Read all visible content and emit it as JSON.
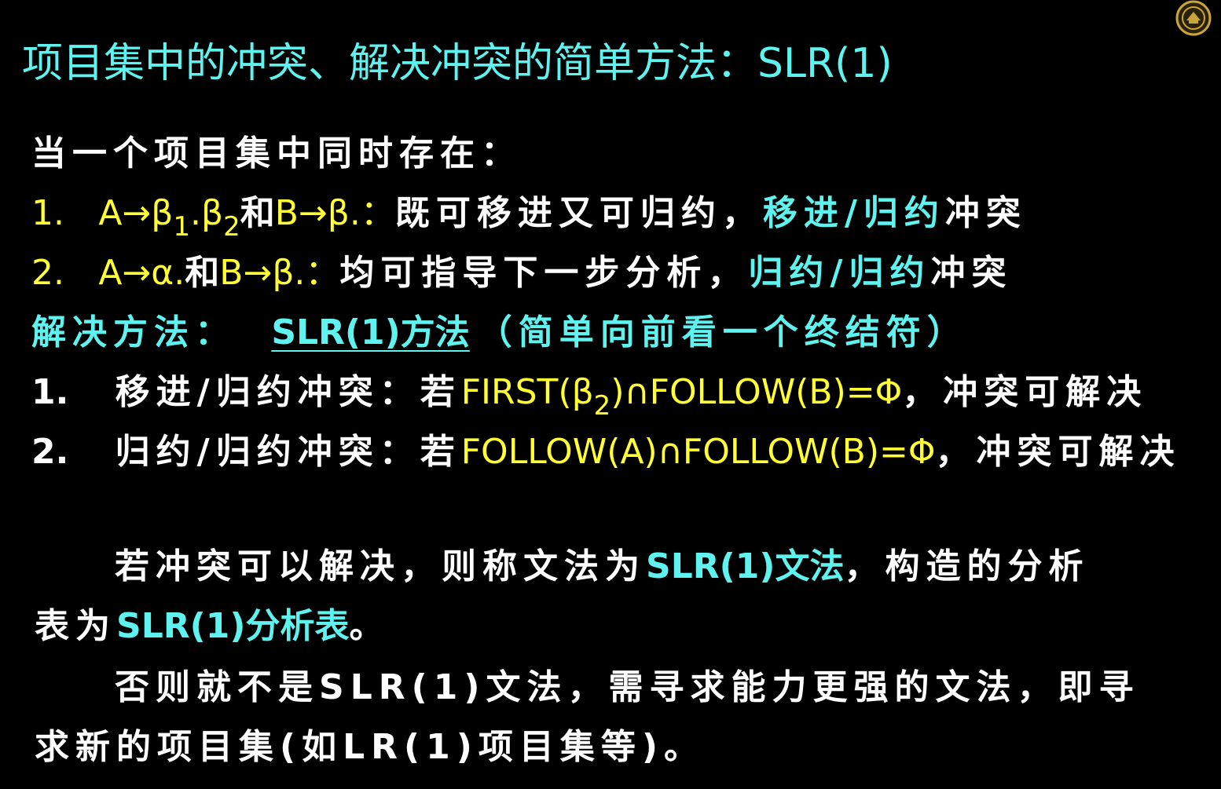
{
  "title": "项目集中的冲突、解决冲突的简单方法：SLR(1)",
  "intro": "当一个项目集中同时存在：",
  "item1": {
    "num": "1.",
    "f1": "A→β",
    "sub1": "1",
    "f2": ".β",
    "sub2": "2",
    "and": "和",
    "f3": "B→β.：",
    "desc": "既可移进又可归约，",
    "conflict": "移进/归约",
    "tail": "冲突"
  },
  "item2": {
    "num": "2.",
    "f1": "A→α.",
    "and": "和",
    "f2": "B→β.：",
    "desc": "均可指导下一步分析，",
    "conflict": "归约/归约",
    "tail": "冲突"
  },
  "solution": {
    "label": "解决方法：",
    "method": "SLR(1)方法",
    "note": "（简单向前看一个终结符）"
  },
  "rule1": {
    "num": "1.",
    "name": "移进/归约冲突：若",
    "f1": "FIRST(β",
    "sub": "2",
    "f2": ")∩FOLLOW(B)=Φ",
    "tail": "，冲突可解决"
  },
  "rule2": {
    "num": "2.",
    "name": "归约/归约冲突：若",
    "formula": "FOLLOW(A)∩FOLLOW(B)=Φ",
    "tail": "，冲突可解决"
  },
  "para1": {
    "a": "若冲突可以解决，则称文法为",
    "b": "SLR(1)文法",
    "c": "，构造的分析",
    "d": "表为",
    "e": "SLR(1)分析表",
    "f": "。"
  },
  "para2": {
    "a": "否则就不是SLR(1)文法，需寻求能力更强的文法，即寻",
    "b": "求新的项目集(如LR(1)项目集等)。"
  },
  "colors": {
    "background": "#000000",
    "cyan": "#5ff3f0",
    "yellow": "#ffff33",
    "white": "#ffffff"
  },
  "logo_icon": "university-seal-icon"
}
